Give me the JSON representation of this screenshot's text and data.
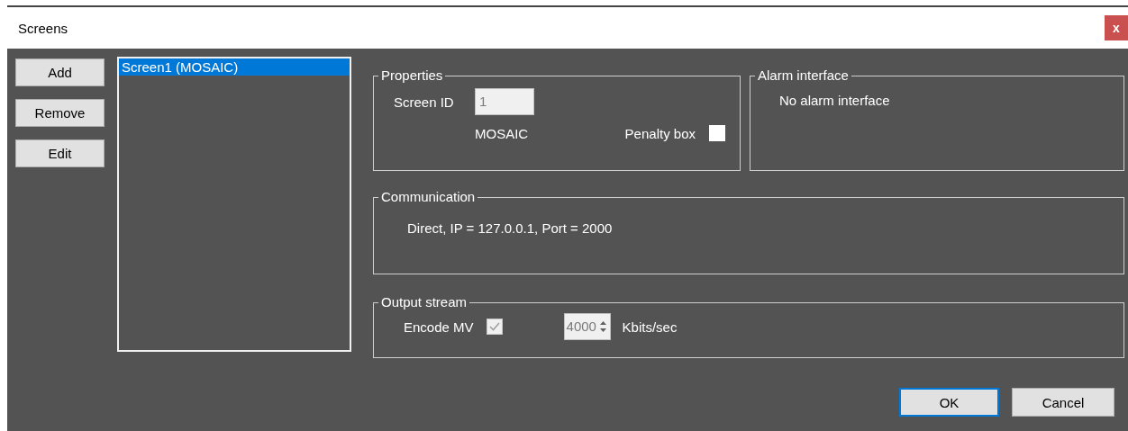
{
  "window": {
    "title": "Screens",
    "close_label": "x"
  },
  "side_buttons": [
    {
      "label": "Add"
    },
    {
      "label": "Remove"
    },
    {
      "label": "Edit"
    }
  ],
  "screen_list": [
    {
      "label": "Screen1 (MOSAIC)",
      "selected": true
    }
  ],
  "properties": {
    "legend": "Properties",
    "screen_id_label": "Screen ID",
    "screen_id_value": "1",
    "mode": "MOSAIC",
    "penalty_label": "Penalty box",
    "penalty_checked": false
  },
  "alarm_interface": {
    "legend": "Alarm interface",
    "text": "No alarm interface"
  },
  "communication": {
    "legend": "Communication",
    "text": "Direct, IP = 127.0.0.1, Port = 2000"
  },
  "output_stream": {
    "legend": "Output stream",
    "encode_label": "Encode MV",
    "encode_checked": true,
    "bitrate_value": "4000",
    "unit": "Kbits/sec"
  },
  "buttons": [
    {
      "label": "OK",
      "default": true
    },
    {
      "label": "Cancel",
      "default": false
    }
  ]
}
